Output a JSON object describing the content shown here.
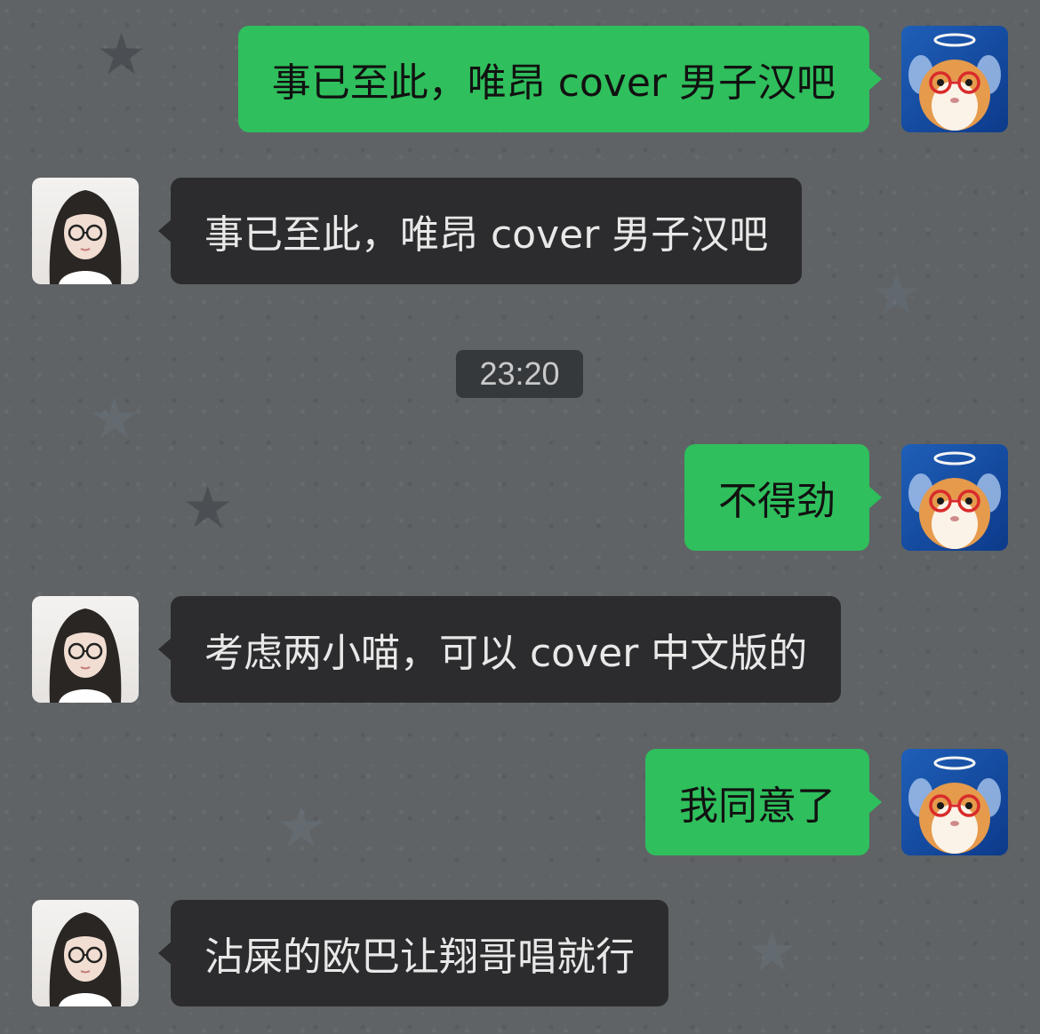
{
  "timestamp": "23:20",
  "messages": [
    {
      "side": "self",
      "text": "事已至此，唯昂 cover 男子汉吧"
    },
    {
      "side": "other",
      "text": "事已至此，唯昂 cover 男子汉吧"
    },
    {
      "side": "self",
      "text": "不得劲"
    },
    {
      "side": "other",
      "text": "考虑两小喵，可以 cover 中文版的"
    },
    {
      "side": "self",
      "text": "我同意了"
    },
    {
      "side": "other",
      "text": "沾屎的欧巴让翔哥唱就行"
    }
  ],
  "avatars": {
    "self": "hamster-angel-avatar",
    "other": "girl-glasses-avatar"
  },
  "colors": {
    "background": "#5f6366",
    "self_bubble": "#2fbf5c",
    "other_bubble": "#2c2c2e"
  }
}
